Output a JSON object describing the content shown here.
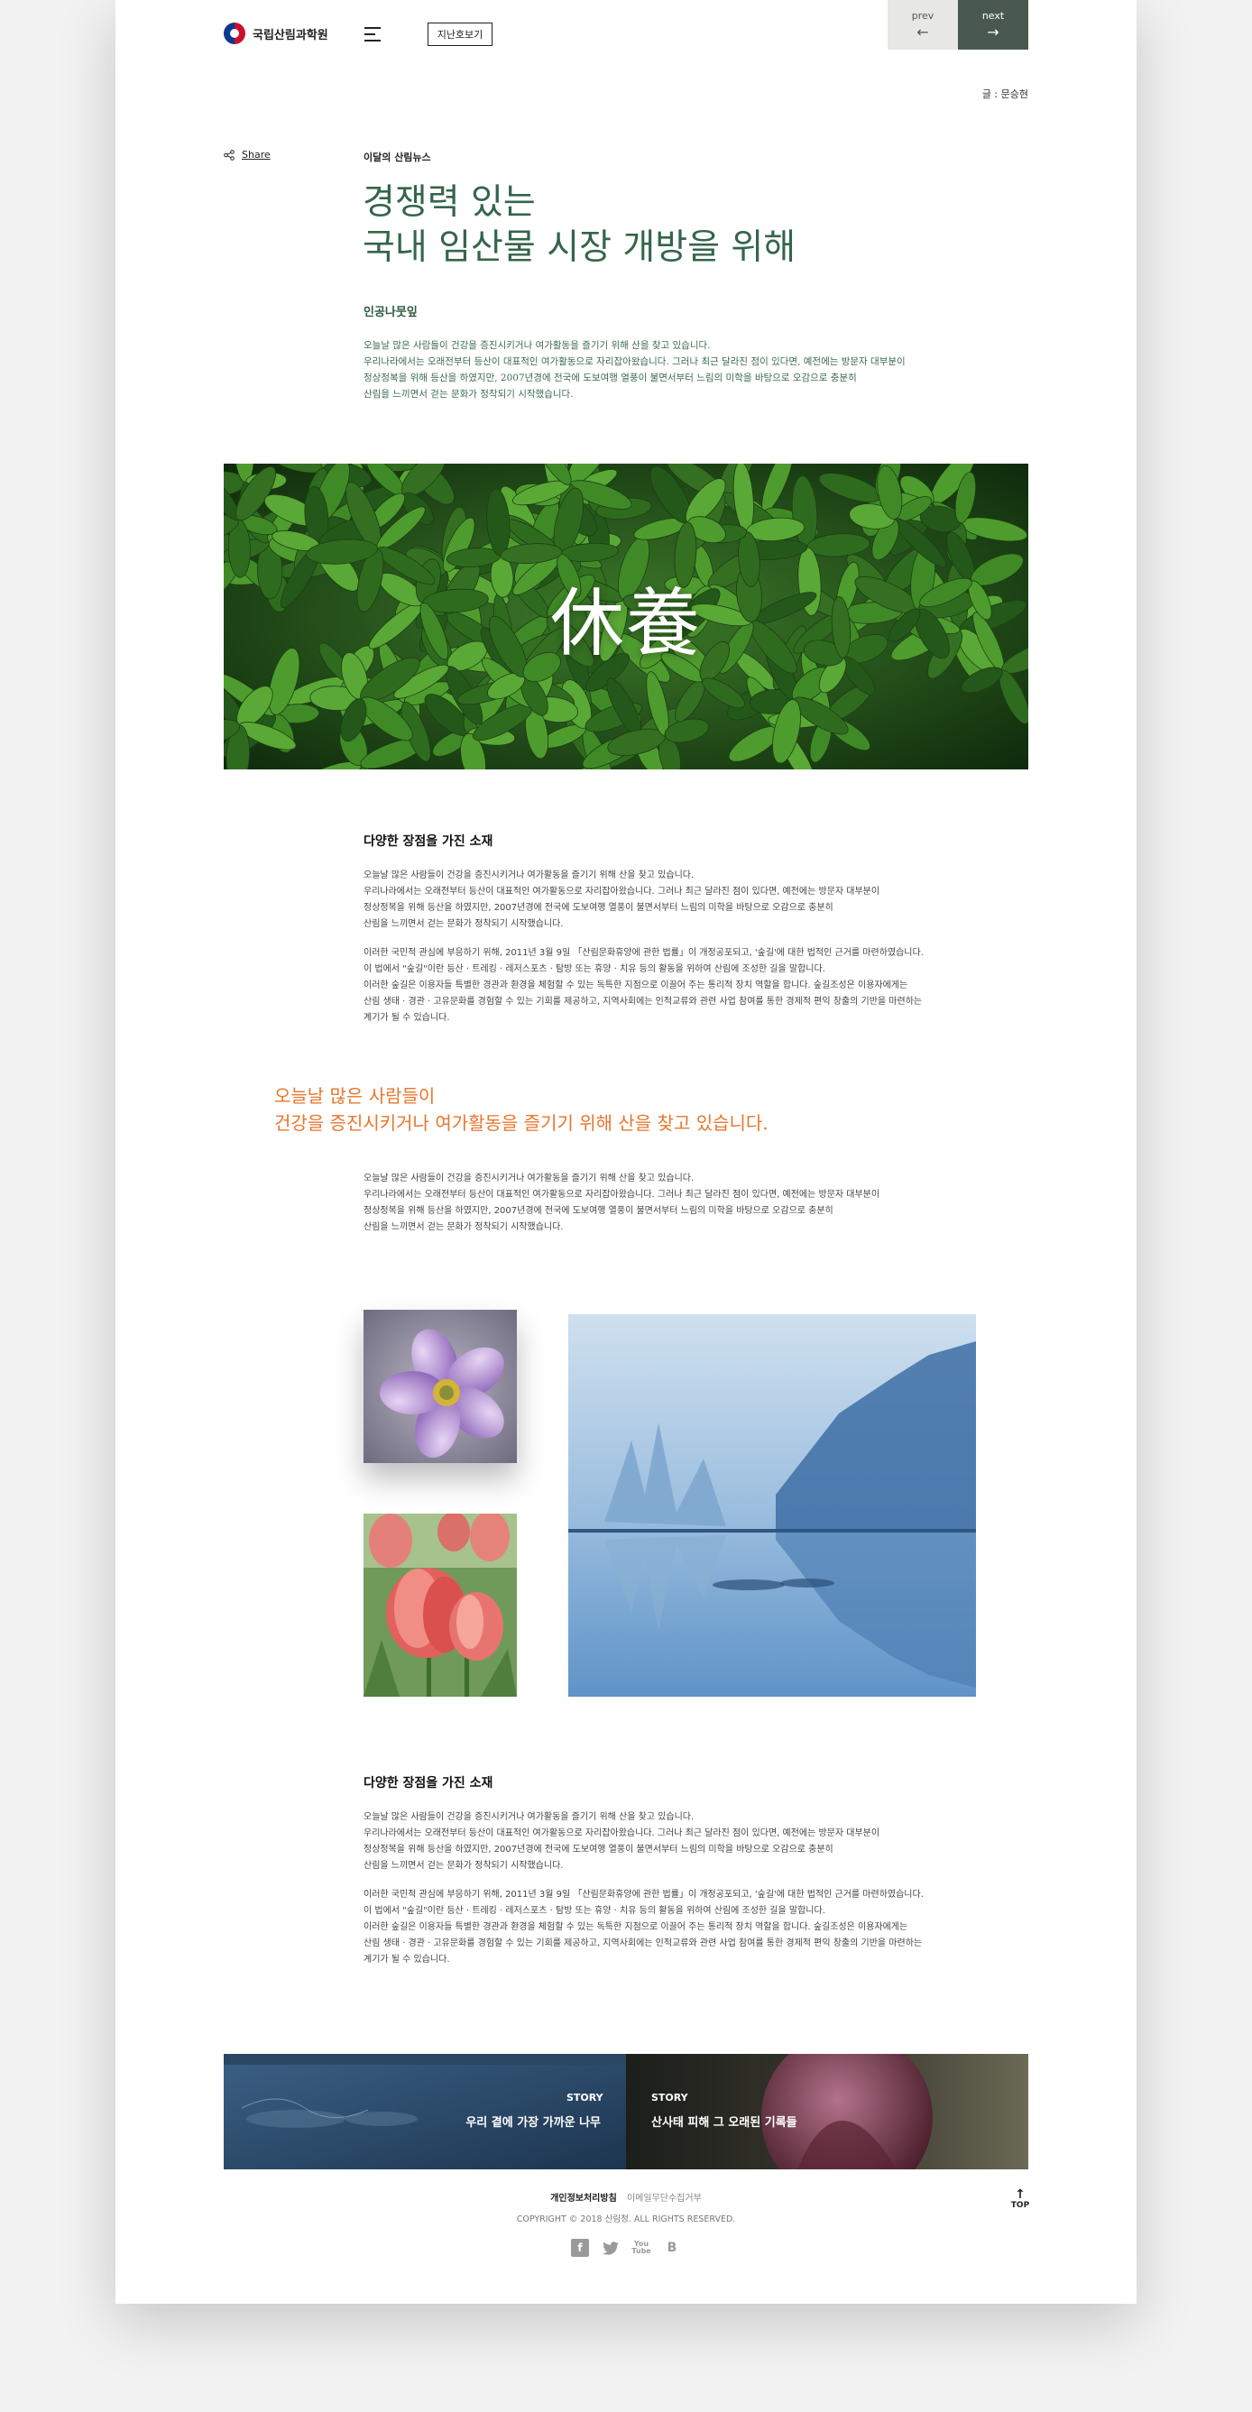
{
  "header": {
    "org_name": "국립산림과학원",
    "issue_button": "지난호보기",
    "prev": {
      "label": "prev",
      "arrow": "←"
    },
    "next": {
      "label": "next",
      "arrow": "→"
    }
  },
  "article": {
    "author": "글 : 문승현",
    "share_label": "Share",
    "category": "이달의 산림뉴스",
    "headline_line1": "경쟁력 있는",
    "headline_line2": "국내 임산물 시장 개방을 위해",
    "subhead": "인공나뭇잎",
    "intro": [
      "오늘날 많은 사람들이 건강을 증진시키거나 여가활동을 즐기기 위해 산을 찾고 있습니다.",
      "우리나라에서는 오래전부터 등산이 대표적인 여가활동으로 자리잡아왔습니다. 그러나 최근 달라진 점이 있다면, 예전에는 방문자 대부분이",
      "정상정복을 위해 등산을 하였지만, 2007년경에 전국에 도보여행 열풍이 불면서부터 느림의 미학을 바탕으로 오감으로 충분히",
      "산림을 느끼면서 걷는 문화가 정착되기 시작했습니다."
    ],
    "hero_title": "休養"
  },
  "section1": {
    "title": "다양한 장점을 가진 소재",
    "p1": [
      "오늘날 많은 사람들이 건강을 증진시키거나 여가활동을 즐기기 위해 산을 찾고 있습니다.",
      "우리나라에서는 오래전부터 등산이 대표적인 여가활동으로 자리잡아왔습니다. 그러나 최근 달라진 점이 있다면, 예전에는 방문자 대부분이",
      "정상정복을 위해 등산을 하였지만, 2007년경에 전국에 도보여행 열풍이 불면서부터 느림의 미학을 바탕으로 오감으로 충분히",
      "산림을 느끼면서 걷는 문화가 정착되기 시작했습니다."
    ],
    "p2": [
      "이러한 국민적 관심에 부응하기 위해, 2011년 3월 9일 「산림문화휴양에 관한 법률」이 개정공포되고, '숲길'에 대한 법적인 근거를 마련하였습니다.",
      "이 법에서 \"숲길\"이란 등산 · 트레킹 · 레저스포츠 · 탐방 또는 휴양 · 치유 등의 활동을 위하여 산림에 조성한 길을 말합니다.",
      "이러한 숲길은 이용자들 특별한 경관과 환경을 체험할 수 있는 독특한 지점으로 이끌어 주는 통리적 장치 역할을 합니다. 숲길조성은 이용자에게는",
      "산림 생태 · 경관 · 고유문화를 경험할 수 있는 기회를 제공하고, 지역사회에는 인적교류와 관련 사업 참여를 통한 경제적 편익 창출의 기반을 마련하는",
      "계기가 될 수 있습니다."
    ]
  },
  "quote": {
    "line1": "오늘날 많은 사람들이",
    "line2": "건강을 증진시키거나 여가활동을 즐기기 위해 산을 찾고 있습니다."
  },
  "section2": {
    "p1": [
      "오늘날 많은 사람들이 건강을 증진시키거나 여가활동을 즐기기 위해 산을 찾고 있습니다.",
      "우리나라에서는 오래전부터 등산이 대표적인 여가활동으로 자리잡아왔습니다. 그러나 최근 달라진 점이 있다면, 예전에는 방문자 대부분이",
      "정상정복을 위해 등산을 하였지만, 2007년경에 전국에 도보여행 열풍이 불면서부터 느림의 미학을 바탕으로 오감으로 충분히",
      "산림을 느끼면서 걷는 문화가 정착되기 시작했습니다."
    ]
  },
  "section3": {
    "title": "다양한 장점을 가진 소재",
    "p1": [
      "오늘날 많은 사람들이 건강을 증진시키거나 여가활동을 즐기기 위해 산을 찾고 있습니다.",
      "우리나라에서는 오래전부터 등산이 대표적인 여가활동으로 자리잡아왔습니다. 그러나 최근 달라진 점이 있다면, 예전에는 방문자 대부분이",
      "정상정복을 위해 등산을 하였지만, 2007년경에 전국에 도보여행 열풍이 불면서부터 느림의 미학을 바탕으로 오감으로 충분히",
      "산림을 느끼면서 걷는 문화가 정착되기 시작했습니다."
    ],
    "p2": [
      "이러한 국민적 관심에 부응하기 위해, 2011년 3월 9일 「산림문화휴양에 관한 법률」이 개정공포되고, '숲길'에 대한 법적인 근거를 마련하였습니다.",
      "이 법에서 \"숲길\"이란 등산 · 트레킹 · 레저스포츠 · 탐방 또는 휴양 · 치유 등의 활동을 위하여 산림에 조성한 길을 말합니다.",
      "이러한 숲길은 이용자들 특별한 경관과 환경을 체험할 수 있는 독특한 지점으로 이끌어 주는 통리적 장치 역할을 합니다. 숲길조성은 이용자에게는",
      "산림 생태 · 경관 · 고유문화를 경험할 수 있는 기회를 제공하고, 지역사회에는 인적교류와 관련 사업 참여를 통한 경제적 편익 창출의 기반을 마련하는",
      "계기가 될 수 있습니다."
    ]
  },
  "stories": [
    {
      "label": "STORY",
      "title": "우리 곁에 가장 가까운 나무"
    },
    {
      "label": "STORY",
      "title": "산사태 피해 그 오래된 기록들"
    }
  ],
  "footer": {
    "privacy": "개인정보처리방침",
    "email_policy": "이메일무단수집거부",
    "copyright": "COPYRIGHT © 2018 산림청. ALL RIGHTS RESERVED.",
    "sns": [
      "f",
      "t",
      "You Tube",
      "B"
    ],
    "sns_icons": [
      "facebook-icon",
      "twitter-icon",
      "youtube-icon",
      "blog-icon"
    ],
    "top_label": "TOP",
    "top_arrow": "↑"
  },
  "colors": {
    "headline": "#34654a",
    "quote": "#e8762d",
    "next_button": "#48584f",
    "prev_button": "#e7e8e6"
  }
}
